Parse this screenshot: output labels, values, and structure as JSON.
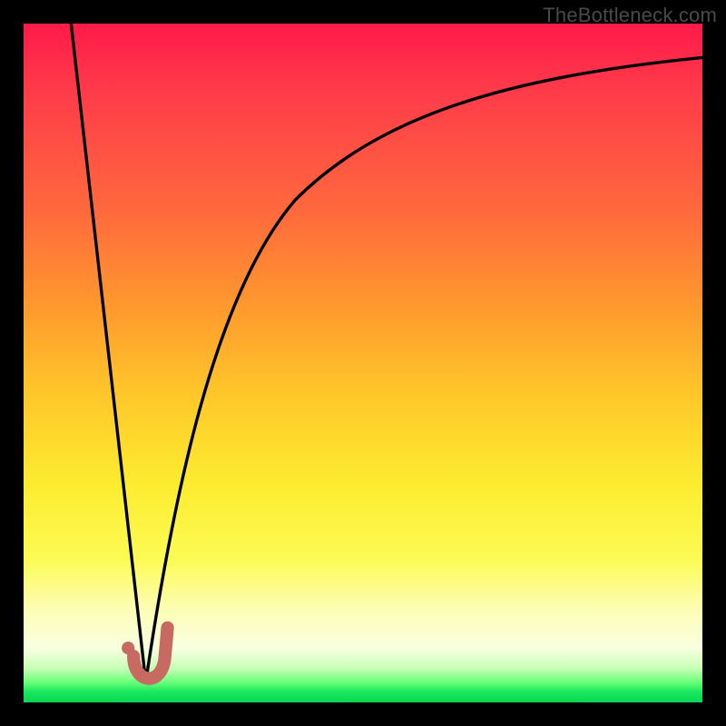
{
  "watermark": "TheBottleneck.com",
  "chart_data": {
    "type": "line",
    "title": "",
    "xlabel": "",
    "ylabel": "",
    "xlim": [
      0,
      100
    ],
    "ylim": [
      0,
      100
    ],
    "grid": false,
    "legend": false,
    "notes": "Heatmap-style vertical gradient background (red top → green bottom) with a black V-shaped bottleneck curve whose minimum is near x≈18. A small salmon 'J'-shaped marker and dot sit at the valley bottom.",
    "series": [
      {
        "name": "left-branch",
        "x": [
          7,
          10,
          13,
          16,
          18
        ],
        "y": [
          100,
          71,
          43,
          14,
          3
        ]
      },
      {
        "name": "right-branch",
        "x": [
          18,
          20,
          22,
          25,
          30,
          38,
          48,
          60,
          74,
          88,
          100
        ],
        "y": [
          3,
          14,
          27,
          41,
          56,
          70,
          80,
          87,
          91,
          93.5,
          95
        ]
      }
    ],
    "marker": {
      "shape": "J",
      "color": "#c66a62",
      "dot_xy": [
        15.5,
        4.5
      ],
      "approx_xy_range": {
        "x": [
          15,
          21
        ],
        "y": [
          1,
          11
        ]
      }
    },
    "background_gradient_stops": [
      {
        "pos": 0.0,
        "color": "#ff1a49"
      },
      {
        "pos": 0.28,
        "color": "#ff6a3d"
      },
      {
        "pos": 0.55,
        "color": "#ffc82a"
      },
      {
        "pos": 0.79,
        "color": "#fbfb55"
      },
      {
        "pos": 0.95,
        "color": "#c7ffb6"
      },
      {
        "pos": 1.0,
        "color": "#0bd654"
      }
    ]
  }
}
